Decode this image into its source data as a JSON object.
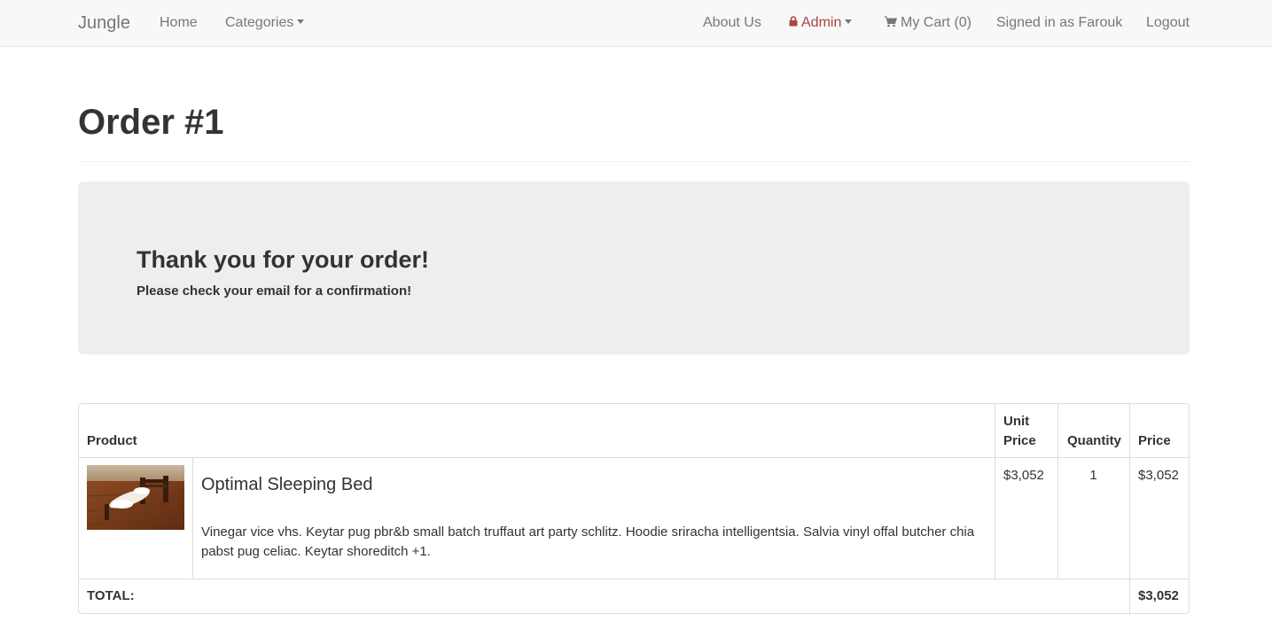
{
  "navbar": {
    "brand": "Jungle",
    "home": "Home",
    "categories": "Categories",
    "about": "About Us",
    "admin": "Admin",
    "cart": "My Cart (0)",
    "signed_in": "Signed in as Farouk",
    "logout": "Logout"
  },
  "page": {
    "title": "Order #1"
  },
  "confirmation": {
    "heading": "Thank you for your order!",
    "message": "Please check your email for a confirmation!"
  },
  "table": {
    "headers": {
      "product": "Product",
      "unit_price_line1": "Unit",
      "unit_price_line2": "Price",
      "quantity": "Quantity",
      "price": "Price"
    },
    "items": [
      {
        "name": "Optimal Sleeping Bed",
        "description": "Vinegar vice vhs. Keytar pug pbr&b small batch truffaut art party schlitz. Hoodie sriracha intelligentsia. Salvia vinyl offal butcher chia pabst pug celiac. Keytar shoreditch +1.",
        "unit_price": "$3,052",
        "quantity": "1",
        "price": "$3,052"
      }
    ],
    "total_label": "TOTAL:",
    "total_value": "$3,052"
  },
  "icons": {
    "lock": "lock-icon",
    "cart": "shopping-cart-icon",
    "caret": "caret-down-icon"
  },
  "colors": {
    "admin": "#a94442",
    "navbar_bg": "#f8f8f8",
    "jumbotron_bg": "#eeeeee"
  }
}
